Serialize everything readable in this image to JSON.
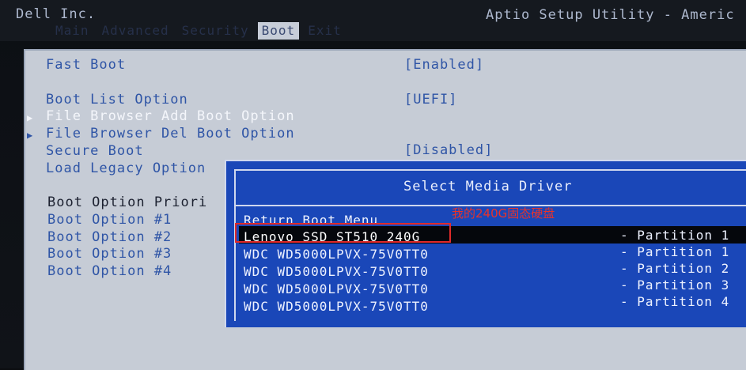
{
  "header": {
    "vendor": "Dell Inc.",
    "utility_title": "Aptio Setup Utility - Americ"
  },
  "tabs": [
    {
      "label": "Main",
      "active": false
    },
    {
      "label": "Advanced",
      "active": false
    },
    {
      "label": "Security",
      "active": false
    },
    {
      "label": "Boot",
      "active": true
    },
    {
      "label": "Exit",
      "active": false
    }
  ],
  "settings": {
    "fast_boot": {
      "label": "Fast Boot",
      "value": "[Enabled]"
    },
    "boot_list_option": {
      "label": "Boot List Option",
      "value": "[UEFI]"
    },
    "file_browser_add": {
      "label": "File Browser Add Boot Option"
    },
    "file_browser_del": {
      "label": "File Browser Del Boot Option"
    },
    "secure_boot": {
      "label": "Secure Boot",
      "value": "[Disabled]"
    },
    "load_legacy": {
      "label": "Load Legacy Option"
    },
    "boot_option_priorities": "Boot Option Priori",
    "boot_options": [
      "Boot Option #1",
      "Boot Option #2",
      "Boot Option #3",
      "Boot Option #4"
    ]
  },
  "dialog": {
    "title": "Select Media Driver",
    "return_item": "Return Boot Menu",
    "drives": [
      {
        "name": "Lenovo SSD ST510 240G",
        "partition": "- Partition 1",
        "selected": true
      },
      {
        "name": "WDC WD5000LPVX-75V0TT0",
        "partition": "- Partition 1",
        "selected": false
      },
      {
        "name": "WDC WD5000LPVX-75V0TT0",
        "partition": "- Partition 2",
        "selected": false
      },
      {
        "name": "WDC WD5000LPVX-75V0TT0",
        "partition": "- Partition 3",
        "selected": false
      },
      {
        "name": "WDC WD5000LPVX-75V0TT0",
        "partition": "- Partition 4",
        "selected": false
      }
    ]
  },
  "annotation": {
    "text": "我的240G固态硬盘",
    "color": "#e8332a"
  },
  "colors": {
    "bios_blue_text": "#2f55a6",
    "dialog_bg": "#1a47b8",
    "panel_bg": "#c6ccd6"
  }
}
